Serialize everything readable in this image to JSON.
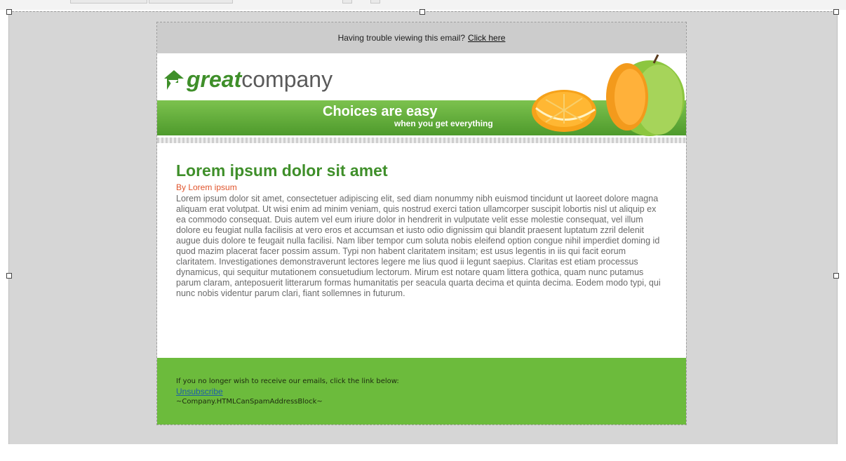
{
  "preheader": {
    "text": "Having trouble viewing this email?",
    "link": "Click here"
  },
  "banner": {
    "logo_bold": "great",
    "logo_rest": "company",
    "tagline": "Choices are easy",
    "subtagline": "when you get everything"
  },
  "article": {
    "title": "Lorem ipsum dolor sit amet",
    "byline": "By Lorem ipsum",
    "body": "Lorem ipsum dolor sit amet, consectetuer adipiscing elit, sed diam nonummy nibh euismod tincidunt ut laoreet dolore magna aliquam erat volutpat. Ut wisi enim ad minim veniam, quis nostrud exerci tation ullamcorper suscipit lobortis nisl ut aliquip ex ea commodo consequat. Duis autem vel eum iriure dolor in hendrerit in vulputate velit esse molestie consequat, vel illum dolore eu feugiat nulla facilisis at vero eros et accumsan et iusto odio dignissim qui blandit praesent luptatum zzril delenit augue duis dolore te feugait nulla facilisi. Nam liber tempor cum soluta nobis eleifend option congue nihil imperdiet doming id quod mazim placerat facer possim assum. Typi non habent claritatem insitam; est usus legentis in iis qui facit eorum claritatem. Investigationes demonstraverunt lectores legere me lius quod ii legunt saepius. Claritas est etiam processus dynamicus, qui sequitur mutationem consuetudium lectorum. Mirum est notare quam littera gothica, quam nunc putamus parum claram, anteposuerit litterarum formas humanitatis per seacula quarta decima et quinta decima. Eodem modo typi, qui nunc nobis videntur parum clari, fiant sollemnes in futurum."
  },
  "footer": {
    "note": "If you no longer wish to receive our emails, click the link below:",
    "unsubscribe": "Unsubscribe",
    "address": "~Company.HTMLCanSpamAddressBlock~"
  },
  "colors": {
    "brand_green": "#3f8f2a",
    "footer_green": "#6cbb3c",
    "byline_orange": "#e0542c",
    "link_blue": "#1e5ea8"
  },
  "icons": [
    "logo-mark-icon",
    "orange-slice-icon",
    "apple-icon"
  ]
}
